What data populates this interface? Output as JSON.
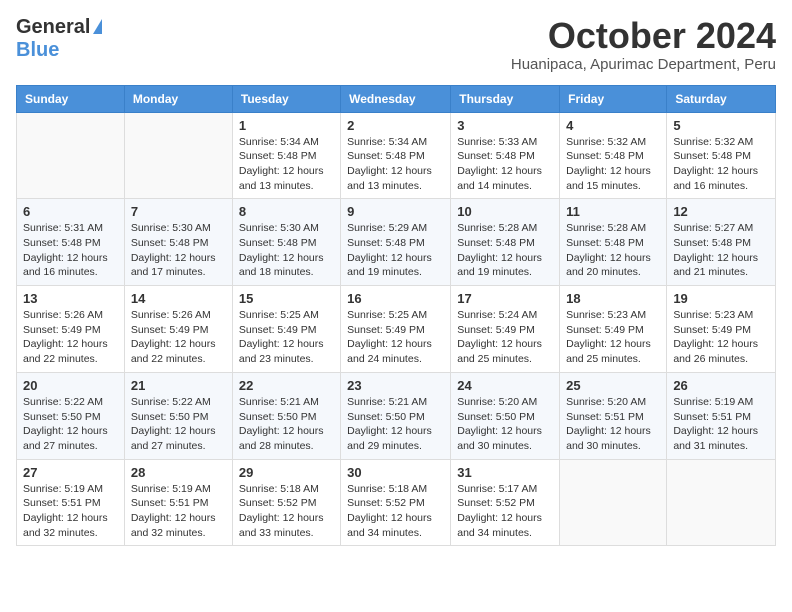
{
  "logo": {
    "general": "General",
    "blue": "Blue"
  },
  "title": "October 2024",
  "location": "Huanipaca, Apurimac Department, Peru",
  "days_of_week": [
    "Sunday",
    "Monday",
    "Tuesday",
    "Wednesday",
    "Thursday",
    "Friday",
    "Saturday"
  ],
  "weeks": [
    [
      {
        "day": "",
        "info": ""
      },
      {
        "day": "",
        "info": ""
      },
      {
        "day": "1",
        "info": "Sunrise: 5:34 AM\nSunset: 5:48 PM\nDaylight: 12 hours and 13 minutes."
      },
      {
        "day": "2",
        "info": "Sunrise: 5:34 AM\nSunset: 5:48 PM\nDaylight: 12 hours and 13 minutes."
      },
      {
        "day": "3",
        "info": "Sunrise: 5:33 AM\nSunset: 5:48 PM\nDaylight: 12 hours and 14 minutes."
      },
      {
        "day": "4",
        "info": "Sunrise: 5:32 AM\nSunset: 5:48 PM\nDaylight: 12 hours and 15 minutes."
      },
      {
        "day": "5",
        "info": "Sunrise: 5:32 AM\nSunset: 5:48 PM\nDaylight: 12 hours and 16 minutes."
      }
    ],
    [
      {
        "day": "6",
        "info": "Sunrise: 5:31 AM\nSunset: 5:48 PM\nDaylight: 12 hours and 16 minutes."
      },
      {
        "day": "7",
        "info": "Sunrise: 5:30 AM\nSunset: 5:48 PM\nDaylight: 12 hours and 17 minutes."
      },
      {
        "day": "8",
        "info": "Sunrise: 5:30 AM\nSunset: 5:48 PM\nDaylight: 12 hours and 18 minutes."
      },
      {
        "day": "9",
        "info": "Sunrise: 5:29 AM\nSunset: 5:48 PM\nDaylight: 12 hours and 19 minutes."
      },
      {
        "day": "10",
        "info": "Sunrise: 5:28 AM\nSunset: 5:48 PM\nDaylight: 12 hours and 19 minutes."
      },
      {
        "day": "11",
        "info": "Sunrise: 5:28 AM\nSunset: 5:48 PM\nDaylight: 12 hours and 20 minutes."
      },
      {
        "day": "12",
        "info": "Sunrise: 5:27 AM\nSunset: 5:48 PM\nDaylight: 12 hours and 21 minutes."
      }
    ],
    [
      {
        "day": "13",
        "info": "Sunrise: 5:26 AM\nSunset: 5:49 PM\nDaylight: 12 hours and 22 minutes."
      },
      {
        "day": "14",
        "info": "Sunrise: 5:26 AM\nSunset: 5:49 PM\nDaylight: 12 hours and 22 minutes."
      },
      {
        "day": "15",
        "info": "Sunrise: 5:25 AM\nSunset: 5:49 PM\nDaylight: 12 hours and 23 minutes."
      },
      {
        "day": "16",
        "info": "Sunrise: 5:25 AM\nSunset: 5:49 PM\nDaylight: 12 hours and 24 minutes."
      },
      {
        "day": "17",
        "info": "Sunrise: 5:24 AM\nSunset: 5:49 PM\nDaylight: 12 hours and 25 minutes."
      },
      {
        "day": "18",
        "info": "Sunrise: 5:23 AM\nSunset: 5:49 PM\nDaylight: 12 hours and 25 minutes."
      },
      {
        "day": "19",
        "info": "Sunrise: 5:23 AM\nSunset: 5:49 PM\nDaylight: 12 hours and 26 minutes."
      }
    ],
    [
      {
        "day": "20",
        "info": "Sunrise: 5:22 AM\nSunset: 5:50 PM\nDaylight: 12 hours and 27 minutes."
      },
      {
        "day": "21",
        "info": "Sunrise: 5:22 AM\nSunset: 5:50 PM\nDaylight: 12 hours and 27 minutes."
      },
      {
        "day": "22",
        "info": "Sunrise: 5:21 AM\nSunset: 5:50 PM\nDaylight: 12 hours and 28 minutes."
      },
      {
        "day": "23",
        "info": "Sunrise: 5:21 AM\nSunset: 5:50 PM\nDaylight: 12 hours and 29 minutes."
      },
      {
        "day": "24",
        "info": "Sunrise: 5:20 AM\nSunset: 5:50 PM\nDaylight: 12 hours and 30 minutes."
      },
      {
        "day": "25",
        "info": "Sunrise: 5:20 AM\nSunset: 5:51 PM\nDaylight: 12 hours and 30 minutes."
      },
      {
        "day": "26",
        "info": "Sunrise: 5:19 AM\nSunset: 5:51 PM\nDaylight: 12 hours and 31 minutes."
      }
    ],
    [
      {
        "day": "27",
        "info": "Sunrise: 5:19 AM\nSunset: 5:51 PM\nDaylight: 12 hours and 32 minutes."
      },
      {
        "day": "28",
        "info": "Sunrise: 5:19 AM\nSunset: 5:51 PM\nDaylight: 12 hours and 32 minutes."
      },
      {
        "day": "29",
        "info": "Sunrise: 5:18 AM\nSunset: 5:52 PM\nDaylight: 12 hours and 33 minutes."
      },
      {
        "day": "30",
        "info": "Sunrise: 5:18 AM\nSunset: 5:52 PM\nDaylight: 12 hours and 34 minutes."
      },
      {
        "day": "31",
        "info": "Sunrise: 5:17 AM\nSunset: 5:52 PM\nDaylight: 12 hours and 34 minutes."
      },
      {
        "day": "",
        "info": ""
      },
      {
        "day": "",
        "info": ""
      }
    ]
  ]
}
